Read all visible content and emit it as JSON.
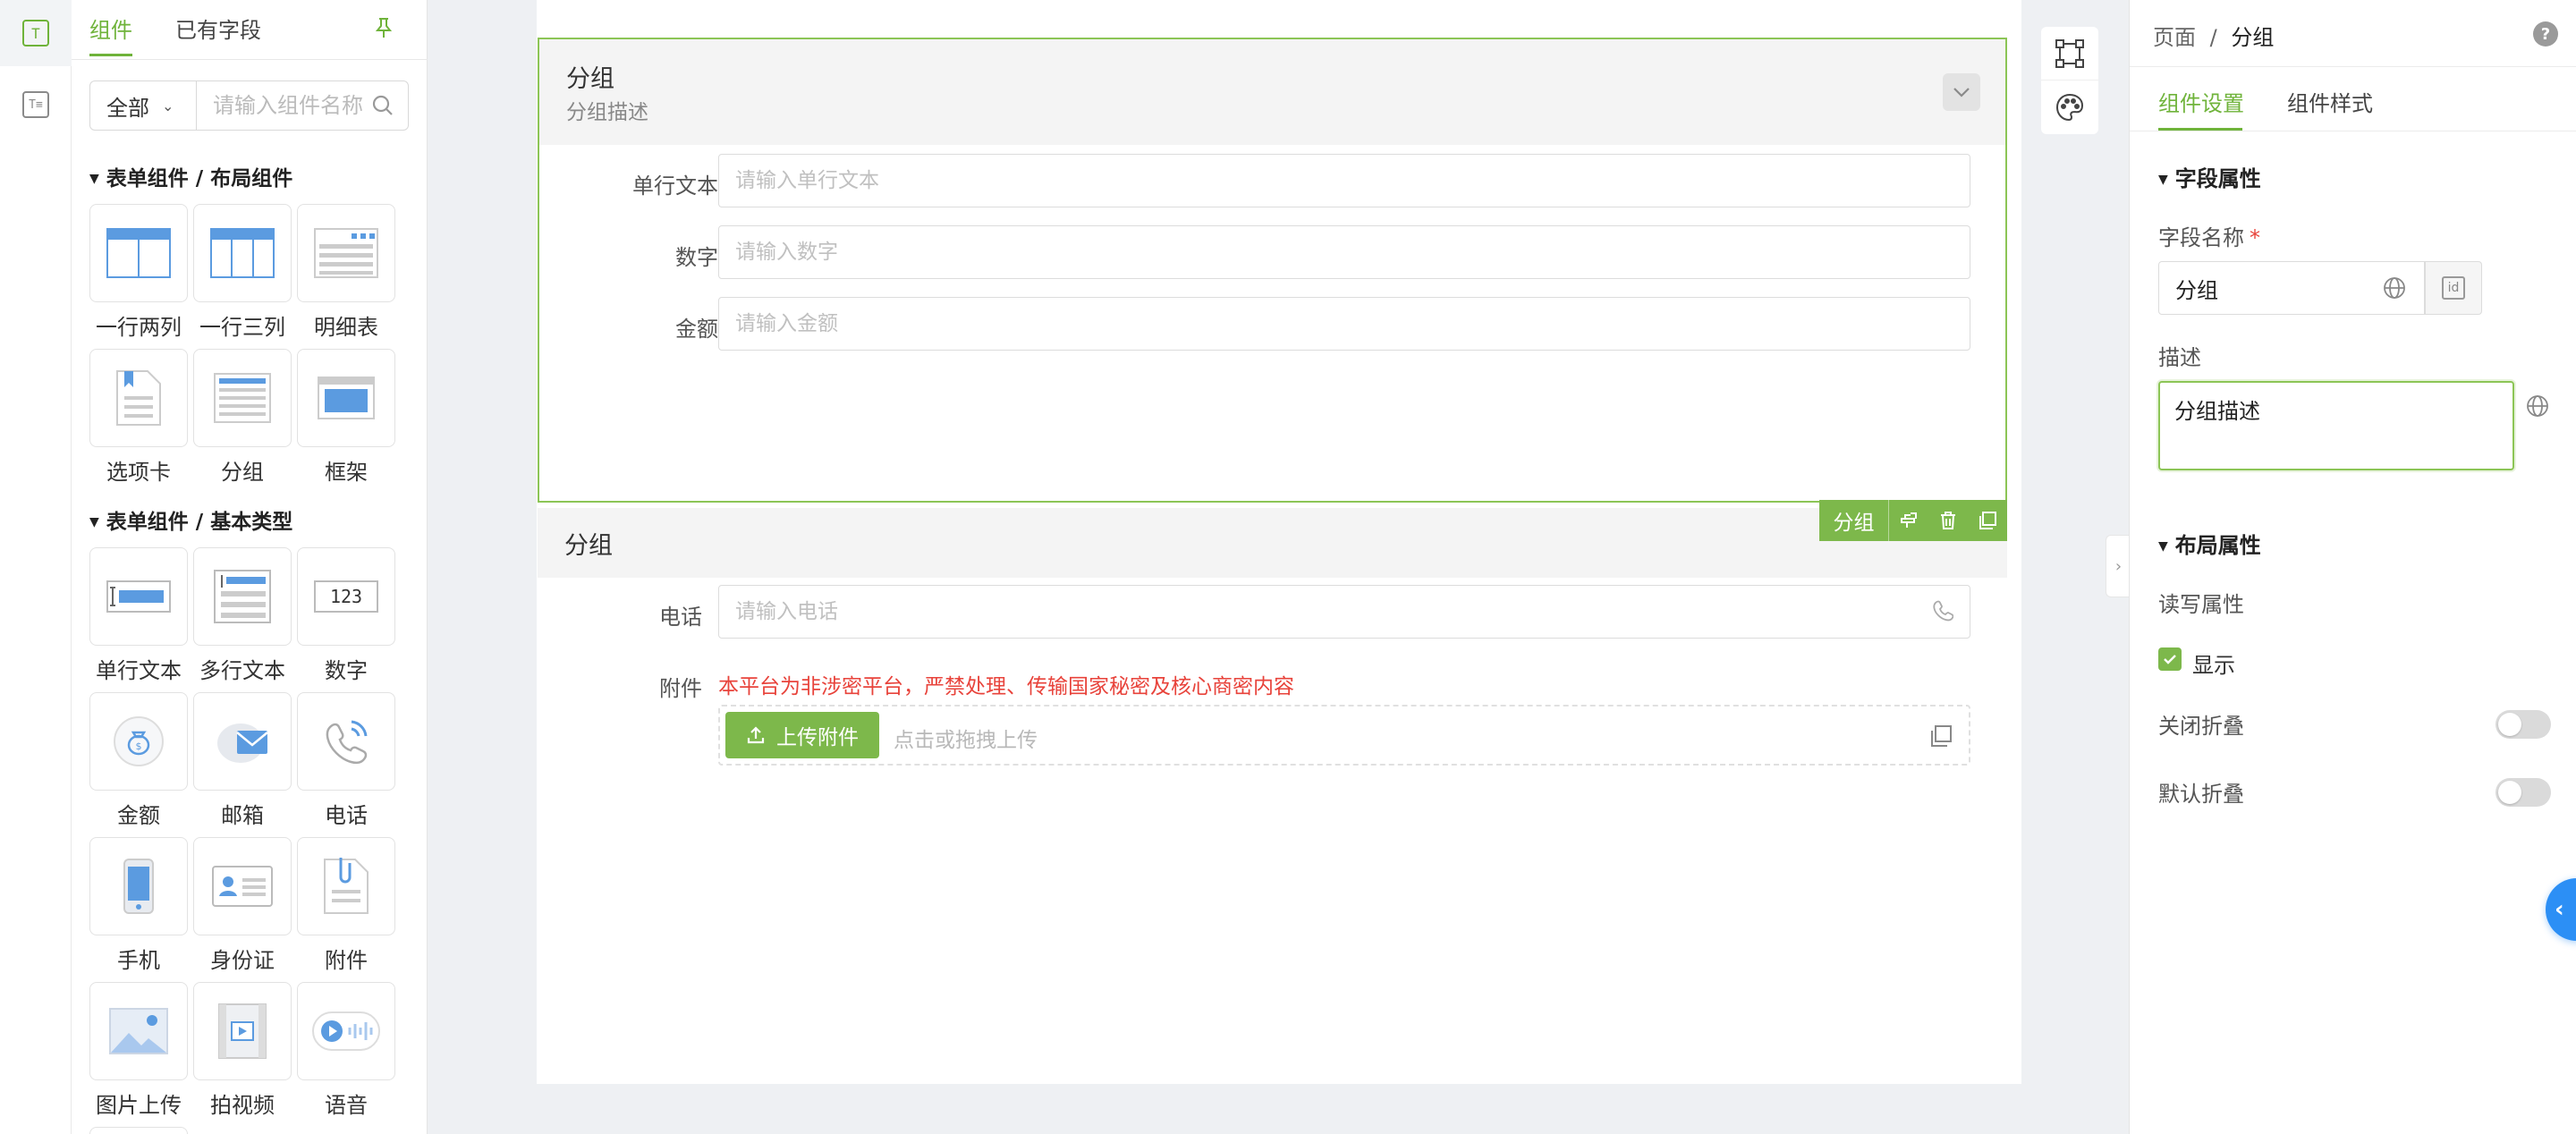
{
  "left_panel": {
    "tabs": [
      "组件",
      "已有字段"
    ],
    "filter_value": "全部",
    "search_placeholder": "请输入组件名称",
    "sections": [
      {
        "title": "表单组件 / 布局组件",
        "items": [
          "一行两列",
          "一行三列",
          "明细表",
          "选项卡",
          "分组",
          "框架"
        ]
      },
      {
        "title": "表单组件 / 基本类型",
        "items": [
          "单行文本",
          "多行文本",
          "数字",
          "金额",
          "邮箱",
          "电话",
          "手机",
          "身份证",
          "附件",
          "图片上传",
          "拍视频",
          "语音"
        ]
      }
    ],
    "number_tile_text": "123"
  },
  "canvas": {
    "group1": {
      "title": "分组",
      "description": "分组描述",
      "fields": [
        {
          "label": "单行文本",
          "placeholder": "请输入单行文本"
        },
        {
          "label": "数字",
          "placeholder": "请输入数字"
        },
        {
          "label": "金额",
          "placeholder": "请输入金额"
        }
      ]
    },
    "toolbar_label": "分组",
    "group2": {
      "title": "分组",
      "phone_label": "电话",
      "phone_placeholder": "请输入电话",
      "attachment_label": "附件",
      "warning": "本平台为非涉密平台，严禁处理、传输国家秘密及核心商密内容",
      "upload_button": "上传附件",
      "upload_hint": "点击或拖拽上传"
    }
  },
  "right_panel": {
    "breadcrumb_parent": "页面",
    "breadcrumb_sep": "/",
    "breadcrumb_current": "分组",
    "help": "?",
    "tabs": [
      "组件设置",
      "组件样式"
    ],
    "field_section": "字段属性",
    "field_name_label": "字段名称",
    "required_mark": "*",
    "field_name_value": "分组",
    "id_text": "id",
    "desc_label": "描述",
    "desc_value": "分组描述",
    "layout_section": "布局属性",
    "rw_label": "读写属性",
    "show_label": "显示",
    "close_fold_label": "关闭折叠",
    "default_fold_label": "默认折叠"
  },
  "colors": {
    "accent": "#7db84b",
    "warning": "#e8433b",
    "float_button": "#2c8ff5"
  }
}
